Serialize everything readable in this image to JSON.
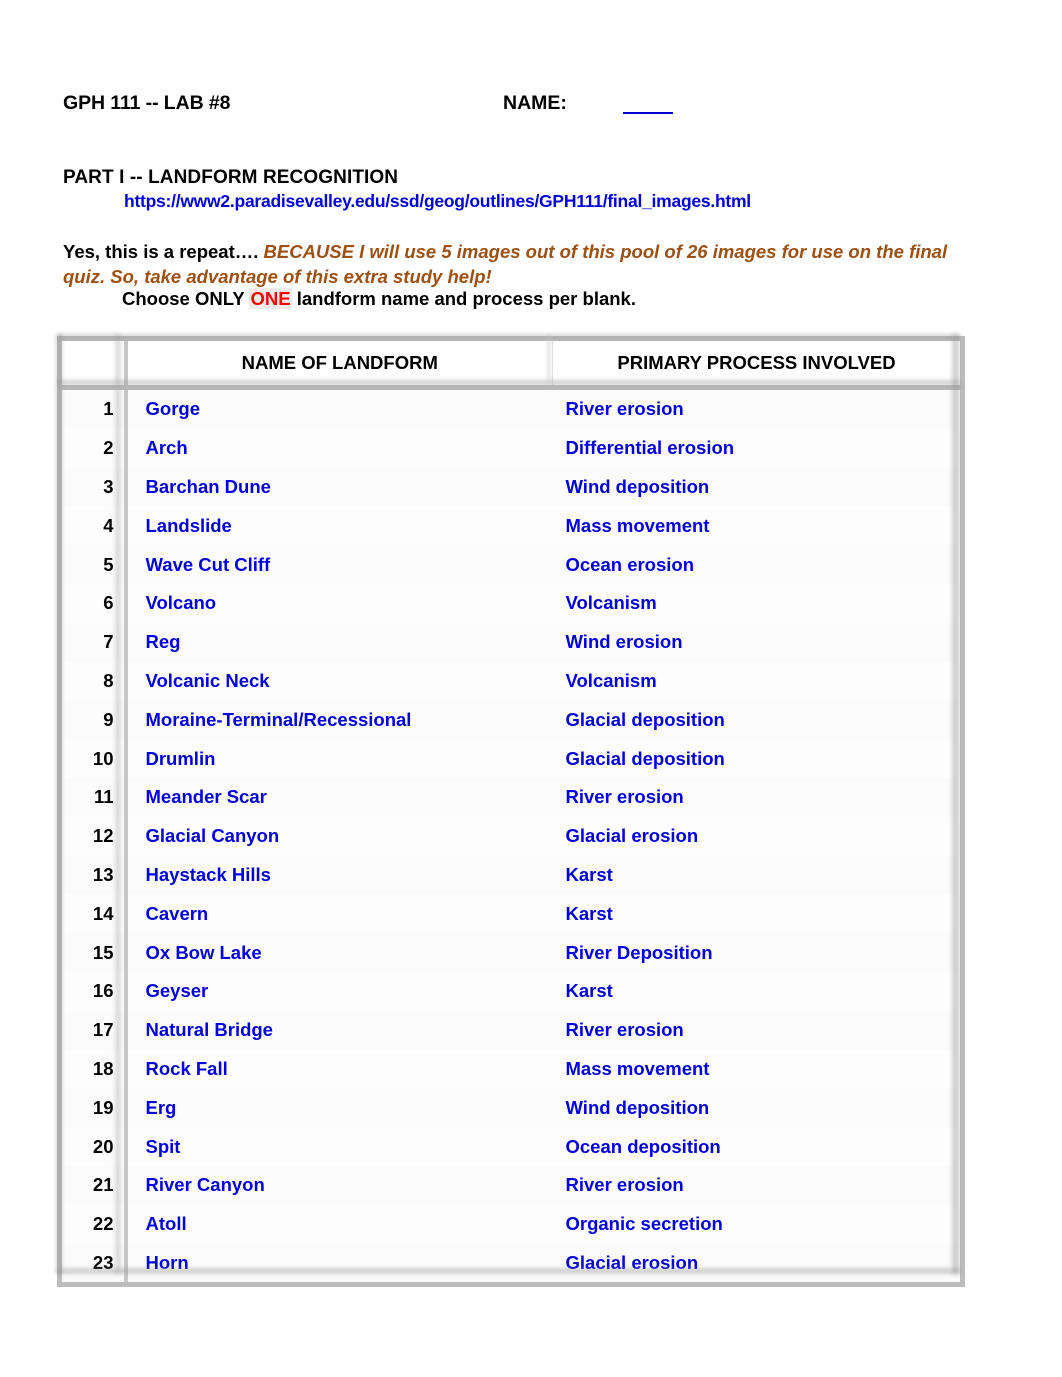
{
  "header": {
    "course_lab": "GPH 111 -- LAB #8",
    "name_label": "NAME:",
    "name_value": ""
  },
  "part1": {
    "heading": "PART I  --  LANDFORM RECOGNITION",
    "url": "https://www2.paradisevalley.edu/ssd/geog/outlines/GPH111/final_images.html",
    "intro_black": "Yes, this is a repeat…. ",
    "intro_brown": "BECAUSE I will use 5 images out of this pool of 26 images for use on the final quiz.  So, take advantage of this extra study help!",
    "choose_before": "Choose ONLY ",
    "choose_highlight": "ONE",
    "choose_after": " landform name and process per blank."
  },
  "table": {
    "columns": [
      "",
      "NAME OF LANDFORM",
      "PRIMARY PROCESS INVOLVED"
    ],
    "rows": [
      {
        "num": "1",
        "landform": "Gorge",
        "process": "River erosion"
      },
      {
        "num": "2",
        "landform": "Arch",
        "process": "Differential erosion"
      },
      {
        "num": "3",
        "landform": "Barchan Dune",
        "process": "Wind deposition"
      },
      {
        "num": "4",
        "landform": "Landslide",
        "process": "Mass movement"
      },
      {
        "num": "5",
        "landform": "Wave Cut Cliff",
        "process": "Ocean erosion"
      },
      {
        "num": "6",
        "landform": "Volcano",
        "process": "Volcanism"
      },
      {
        "num": "7",
        "landform": "Reg",
        "process": "Wind erosion"
      },
      {
        "num": "8",
        "landform": "Volcanic Neck",
        "process": "Volcanism"
      },
      {
        "num": "9",
        "landform": "Moraine-Terminal/Recessional",
        "process": "Glacial deposition"
      },
      {
        "num": "10",
        "landform": "Drumlin",
        "process": "Glacial deposition"
      },
      {
        "num": "11",
        "landform": "Meander Scar",
        "process": "River erosion"
      },
      {
        "num": "12",
        "landform": "Glacial Canyon",
        "process": "Glacial erosion"
      },
      {
        "num": "13",
        "landform": "Haystack Hills",
        "process": "Karst"
      },
      {
        "num": "14",
        "landform": "Cavern",
        "process": "Karst"
      },
      {
        "num": "15",
        "landform": "Ox Bow Lake",
        "process": "River Deposition"
      },
      {
        "num": "16",
        "landform": "Geyser",
        "process": "Karst"
      },
      {
        "num": "17",
        "landform": "Natural Bridge",
        "process": "River erosion"
      },
      {
        "num": "18",
        "landform": "Rock Fall",
        "process": "Mass movement"
      },
      {
        "num": "19",
        "landform": "Erg",
        "process": "Wind deposition"
      },
      {
        "num": "20",
        "landform": "Spit",
        "process": "Ocean deposition"
      },
      {
        "num": "21",
        "landform": "River Canyon",
        "process": "River erosion"
      },
      {
        "num": "22",
        "landform": "Atoll",
        "process": "Organic  secretion"
      },
      {
        "num": "23",
        "landform": "Horn",
        "process": "Glacial erosion"
      }
    ]
  },
  "colors": {
    "link_blue": "#0000e0",
    "answer_blue": "#0000e0",
    "emphasis_brown": "#9e4f12",
    "highlight_red": "#ff0000",
    "table_border_gray": "#bdbdbd"
  }
}
